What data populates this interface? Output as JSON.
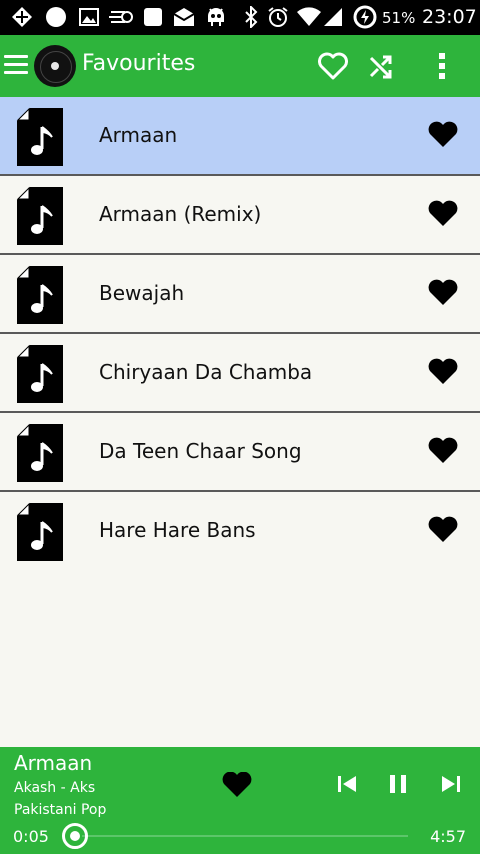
{
  "status_bar": {
    "battery_percent": "51%",
    "time": "23:07"
  },
  "app_bar": {
    "title": "Favourites"
  },
  "songs": [
    {
      "title": "Armaan",
      "favourite": true,
      "active": true
    },
    {
      "title": "Armaan (Remix)",
      "favourite": true,
      "active": false
    },
    {
      "title": "Bewajah",
      "favourite": true,
      "active": false
    },
    {
      "title": "Chiryaan Da Chamba",
      "favourite": true,
      "active": false
    },
    {
      "title": "Da Teen Chaar Song",
      "favourite": true,
      "active": false
    },
    {
      "title": "Hare Hare Bans",
      "favourite": true,
      "active": false
    }
  ],
  "now_playing": {
    "title": "Armaan",
    "artist": "Akash - Aks",
    "genre": "Pakistani Pop",
    "current_time": "0:05",
    "total_time": "4:57",
    "progress_fraction": 0.017
  },
  "colors": {
    "accent": "#2eb43c",
    "active_row": "#b8cff7",
    "background": "#f7f7f2"
  },
  "icons": {
    "menu": "hamburger-icon",
    "logo": "vinyl-record-icon",
    "favourites": "heart-outline-icon",
    "shuffle": "shuffle-icon",
    "overflow": "more-vert-icon",
    "song": "music-file-icon",
    "favourite_filled": "heart-filled-icon",
    "previous": "skip-previous-icon",
    "pause": "pause-icon",
    "next": "skip-next-icon"
  }
}
